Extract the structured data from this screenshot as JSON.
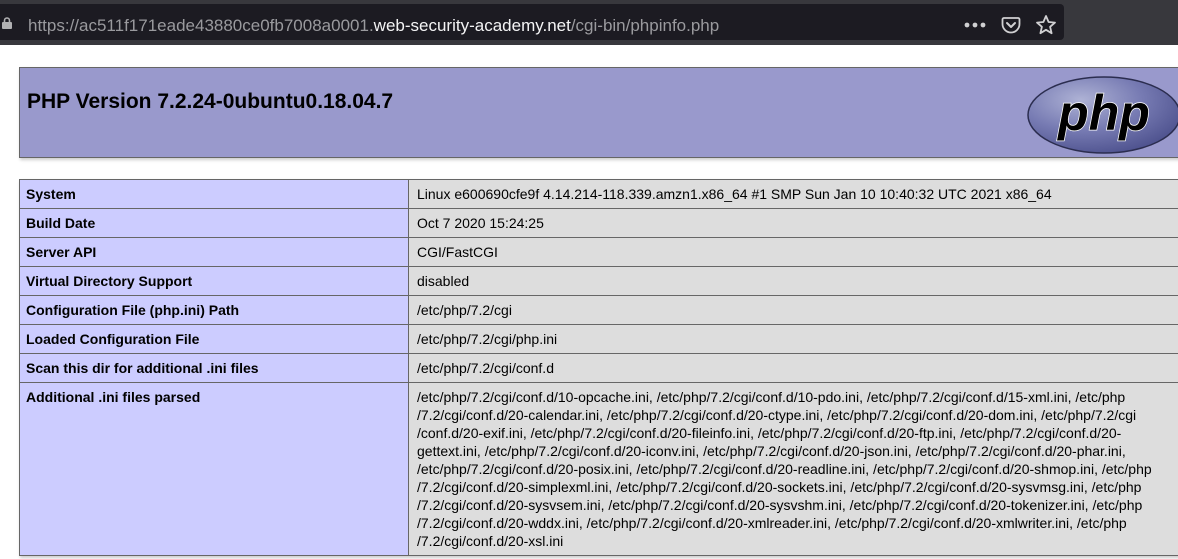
{
  "browser": {
    "url_prefix": "https://ac511f171eade43880ce0fb7008a0001.",
    "url_host": "web-security-academy.net",
    "url_path": "/cgi-bin/phpinfo.php",
    "icons": [
      "lock-icon",
      "more-icon",
      "pocket-icon",
      "bookmark-star-icon"
    ]
  },
  "header": {
    "title": "PHP Version 7.2.24-0ubuntu0.18.04.7",
    "logo_text": "php"
  },
  "rows": [
    {
      "key": "System",
      "value": "Linux e600690cfe9f 4.14.214-118.339.amzn1.x86_64 #1 SMP Sun Jan 10 10:40:32 UTC 2021 x86_64"
    },
    {
      "key": "Build Date",
      "value": "Oct 7 2020 15:24:25"
    },
    {
      "key": "Server API",
      "value": "CGI/FastCGI"
    },
    {
      "key": "Virtual Directory Support",
      "value": "disabled"
    },
    {
      "key": "Configuration File (php.ini) Path",
      "value": "/etc/php/7.2/cgi"
    },
    {
      "key": "Loaded Configuration File",
      "value": "/etc/php/7.2/cgi/php.ini"
    },
    {
      "key": "Scan this dir for additional .ini files",
      "value": "/etc/php/7.2/cgi/conf.d"
    },
    {
      "key": "Additional .ini files parsed",
      "value_lines": [
        "/etc/php/7.2/cgi/conf.d/10-opcache.ini, /etc/php/7.2/cgi/conf.d/10-pdo.ini, /etc/php/7.2/cgi/conf.d/15-xml.ini, /etc/php",
        "/7.2/cgi/conf.d/20-calendar.ini, /etc/php/7.2/cgi/conf.d/20-ctype.ini, /etc/php/7.2/cgi/conf.d/20-dom.ini, /etc/php/7.2/cgi",
        "/conf.d/20-exif.ini, /etc/php/7.2/cgi/conf.d/20-fileinfo.ini, /etc/php/7.2/cgi/conf.d/20-ftp.ini, /etc/php/7.2/cgi/conf.d/20-",
        "gettext.ini, /etc/php/7.2/cgi/conf.d/20-iconv.ini, /etc/php/7.2/cgi/conf.d/20-json.ini, /etc/php/7.2/cgi/conf.d/20-phar.ini,",
        "/etc/php/7.2/cgi/conf.d/20-posix.ini, /etc/php/7.2/cgi/conf.d/20-readline.ini, /etc/php/7.2/cgi/conf.d/20-shmop.ini, /etc/php",
        "/7.2/cgi/conf.d/20-simplexml.ini, /etc/php/7.2/cgi/conf.d/20-sockets.ini, /etc/php/7.2/cgi/conf.d/20-sysvmsg.ini, /etc/php",
        "/7.2/cgi/conf.d/20-sysvsem.ini, /etc/php/7.2/cgi/conf.d/20-sysvshm.ini, /etc/php/7.2/cgi/conf.d/20-tokenizer.ini, /etc/php",
        "/7.2/cgi/conf.d/20-wddx.ini, /etc/php/7.2/cgi/conf.d/20-xmlreader.ini, /etc/php/7.2/cgi/conf.d/20-xmlwriter.ini, /etc/php",
        "/7.2/cgi/conf.d/20-xsl.ini"
      ]
    }
  ],
  "colors": {
    "header_bg": "#9999cc",
    "key_bg": "#ccccff",
    "value_bg": "#dddddd",
    "browser_bar": "#38383d"
  }
}
